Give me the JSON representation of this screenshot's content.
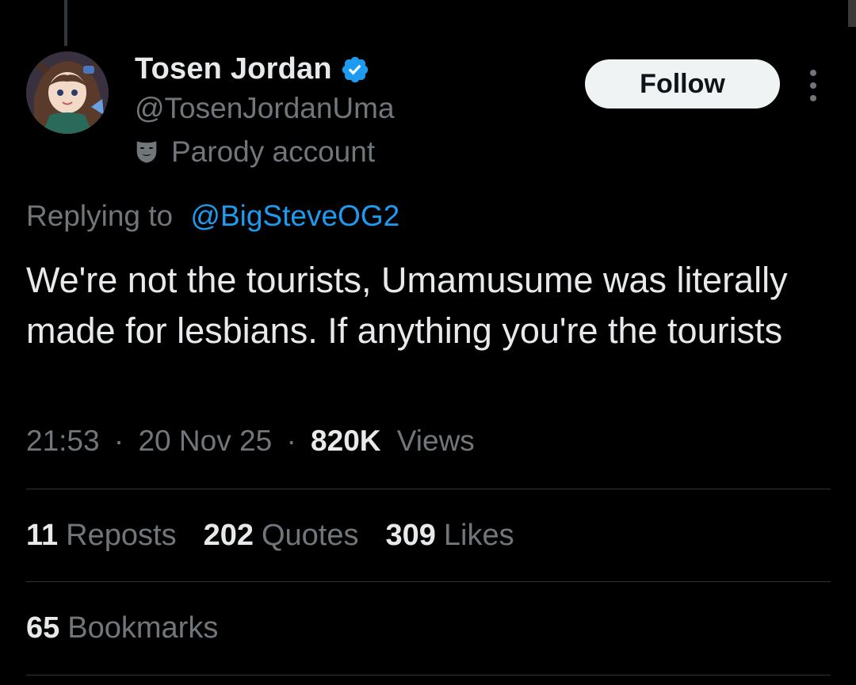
{
  "author": {
    "display_name": "Tosen Jordan",
    "handle": "@TosenJordanUma",
    "label": "Parody account",
    "verified": true,
    "verified_color": "#1d9bf0"
  },
  "actions": {
    "follow_label": "Follow"
  },
  "reply": {
    "prefix": "Replying to",
    "mention": "@BigSteveOG2"
  },
  "tweet": {
    "text": "We're not the tourists, Umamusume was literally made for lesbians. If anything you're the tourists"
  },
  "meta": {
    "time": "21:53",
    "date": "20 Nov 25",
    "views_count": "820K",
    "views_label": "Views",
    "separator": "·"
  },
  "stats": [
    {
      "count": "11",
      "label": "Reposts"
    },
    {
      "count": "202",
      "label": "Quotes"
    },
    {
      "count": "309",
      "label": "Likes"
    }
  ],
  "bookmarks": {
    "count": "65",
    "label": "Bookmarks"
  },
  "icons": {
    "verified": "verified-badge-icon",
    "parody": "mask-icon",
    "more": "more-vertical-icon"
  },
  "colors": {
    "background": "#000000",
    "text": "#e7e9ea",
    "secondary": "#71767b",
    "link": "#1d9bf0",
    "button": "#eff3f4"
  }
}
